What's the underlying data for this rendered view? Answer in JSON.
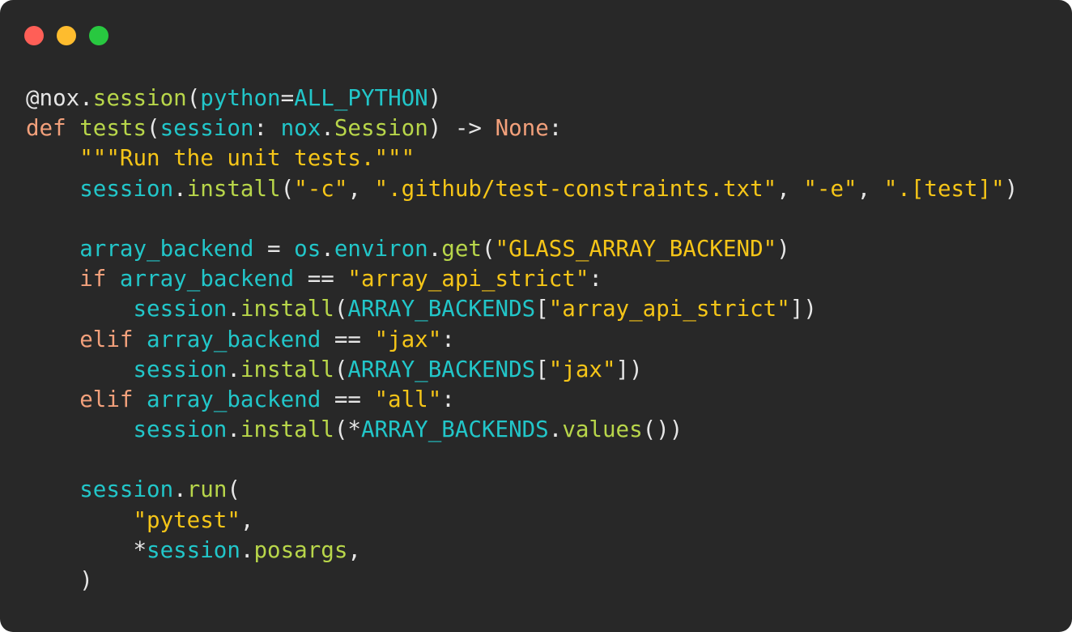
{
  "window": {
    "controls": [
      {
        "name": "close-button",
        "color": "#ff5f57"
      },
      {
        "name": "minimize-button",
        "color": "#febc2e"
      },
      {
        "name": "zoom-button",
        "color": "#28c840"
      }
    ]
  },
  "palette": {
    "default": "#e6e6e6",
    "keyword": "#f2a07b",
    "function": "#b8d64a",
    "identifier": "#22c6c9",
    "string": "#f5c518",
    "constant": "#22c6c9",
    "none": "#f2a07b"
  },
  "code_lines": [
    [
      {
        "t": "@nox",
        "c": "default"
      },
      {
        "t": ".",
        "c": "default"
      },
      {
        "t": "session",
        "c": "function"
      },
      {
        "t": "(",
        "c": "default"
      },
      {
        "t": "python",
        "c": "identifier"
      },
      {
        "t": "=",
        "c": "default"
      },
      {
        "t": "ALL_PYTHON",
        "c": "constant"
      },
      {
        "t": ")",
        "c": "default"
      }
    ],
    [
      {
        "t": "def",
        "c": "keyword"
      },
      {
        "t": " ",
        "c": "default"
      },
      {
        "t": "tests",
        "c": "function"
      },
      {
        "t": "(",
        "c": "default"
      },
      {
        "t": "session",
        "c": "identifier"
      },
      {
        "t": ": ",
        "c": "default"
      },
      {
        "t": "nox",
        "c": "identifier"
      },
      {
        "t": ".",
        "c": "default"
      },
      {
        "t": "Session",
        "c": "function"
      },
      {
        "t": ") -> ",
        "c": "default"
      },
      {
        "t": "None",
        "c": "none"
      },
      {
        "t": ":",
        "c": "default"
      }
    ],
    [
      {
        "t": "    ",
        "c": "default"
      },
      {
        "t": "\"\"\"Run the unit tests.\"\"\"",
        "c": "string"
      }
    ],
    [
      {
        "t": "    ",
        "c": "default"
      },
      {
        "t": "session",
        "c": "identifier"
      },
      {
        "t": ".",
        "c": "default"
      },
      {
        "t": "install",
        "c": "function"
      },
      {
        "t": "(",
        "c": "default"
      },
      {
        "t": "\"-c\"",
        "c": "string"
      },
      {
        "t": ", ",
        "c": "default"
      },
      {
        "t": "\".github/test-constraints.txt\"",
        "c": "string"
      },
      {
        "t": ", ",
        "c": "default"
      },
      {
        "t": "\"-e\"",
        "c": "string"
      },
      {
        "t": ", ",
        "c": "default"
      },
      {
        "t": "\".[test]\"",
        "c": "string"
      },
      {
        "t": ")",
        "c": "default"
      }
    ],
    [],
    [
      {
        "t": "    ",
        "c": "default"
      },
      {
        "t": "array_backend",
        "c": "identifier"
      },
      {
        "t": " = ",
        "c": "default"
      },
      {
        "t": "os",
        "c": "identifier"
      },
      {
        "t": ".",
        "c": "default"
      },
      {
        "t": "environ",
        "c": "identifier"
      },
      {
        "t": ".",
        "c": "default"
      },
      {
        "t": "get",
        "c": "function"
      },
      {
        "t": "(",
        "c": "default"
      },
      {
        "t": "\"GLASS_ARRAY_BACKEND\"",
        "c": "string"
      },
      {
        "t": ")",
        "c": "default"
      }
    ],
    [
      {
        "t": "    ",
        "c": "default"
      },
      {
        "t": "if",
        "c": "keyword"
      },
      {
        "t": " ",
        "c": "default"
      },
      {
        "t": "array_backend",
        "c": "identifier"
      },
      {
        "t": " == ",
        "c": "default"
      },
      {
        "t": "\"array_api_strict\"",
        "c": "string"
      },
      {
        "t": ":",
        "c": "default"
      }
    ],
    [
      {
        "t": "        ",
        "c": "default"
      },
      {
        "t": "session",
        "c": "identifier"
      },
      {
        "t": ".",
        "c": "default"
      },
      {
        "t": "install",
        "c": "function"
      },
      {
        "t": "(",
        "c": "default"
      },
      {
        "t": "ARRAY_BACKENDS",
        "c": "constant"
      },
      {
        "t": "[",
        "c": "default"
      },
      {
        "t": "\"array_api_strict\"",
        "c": "string"
      },
      {
        "t": "])",
        "c": "default"
      }
    ],
    [
      {
        "t": "    ",
        "c": "default"
      },
      {
        "t": "elif",
        "c": "keyword"
      },
      {
        "t": " ",
        "c": "default"
      },
      {
        "t": "array_backend",
        "c": "identifier"
      },
      {
        "t": " == ",
        "c": "default"
      },
      {
        "t": "\"jax\"",
        "c": "string"
      },
      {
        "t": ":",
        "c": "default"
      }
    ],
    [
      {
        "t": "        ",
        "c": "default"
      },
      {
        "t": "session",
        "c": "identifier"
      },
      {
        "t": ".",
        "c": "default"
      },
      {
        "t": "install",
        "c": "function"
      },
      {
        "t": "(",
        "c": "default"
      },
      {
        "t": "ARRAY_BACKENDS",
        "c": "constant"
      },
      {
        "t": "[",
        "c": "default"
      },
      {
        "t": "\"jax\"",
        "c": "string"
      },
      {
        "t": "])",
        "c": "default"
      }
    ],
    [
      {
        "t": "    ",
        "c": "default"
      },
      {
        "t": "elif",
        "c": "keyword"
      },
      {
        "t": " ",
        "c": "default"
      },
      {
        "t": "array_backend",
        "c": "identifier"
      },
      {
        "t": " == ",
        "c": "default"
      },
      {
        "t": "\"all\"",
        "c": "string"
      },
      {
        "t": ":",
        "c": "default"
      }
    ],
    [
      {
        "t": "        ",
        "c": "default"
      },
      {
        "t": "session",
        "c": "identifier"
      },
      {
        "t": ".",
        "c": "default"
      },
      {
        "t": "install",
        "c": "function"
      },
      {
        "t": "(*",
        "c": "default"
      },
      {
        "t": "ARRAY_BACKENDS",
        "c": "constant"
      },
      {
        "t": ".",
        "c": "default"
      },
      {
        "t": "values",
        "c": "function"
      },
      {
        "t": "())",
        "c": "default"
      }
    ],
    [],
    [
      {
        "t": "    ",
        "c": "default"
      },
      {
        "t": "session",
        "c": "identifier"
      },
      {
        "t": ".",
        "c": "default"
      },
      {
        "t": "run",
        "c": "function"
      },
      {
        "t": "(",
        "c": "default"
      }
    ],
    [
      {
        "t": "        ",
        "c": "default"
      },
      {
        "t": "\"pytest\"",
        "c": "string"
      },
      {
        "t": ",",
        "c": "default"
      }
    ],
    [
      {
        "t": "        *",
        "c": "default"
      },
      {
        "t": "session",
        "c": "identifier"
      },
      {
        "t": ".",
        "c": "default"
      },
      {
        "t": "posargs",
        "c": "function"
      },
      {
        "t": ",",
        "c": "default"
      }
    ],
    [
      {
        "t": "    )",
        "c": "default"
      }
    ]
  ]
}
